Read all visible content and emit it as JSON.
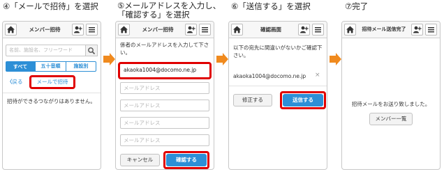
{
  "steps": [
    {
      "title": "④「メールで招待」を選択",
      "header": "メンバー招待",
      "search_placeholder": "名前、施設名、フリーワード",
      "tabs": [
        "すべて",
        "五十音順",
        "施設別"
      ],
      "back": "戻る",
      "mail_invite": "メールで招待",
      "message": "招待ができるつながりはありません。"
    },
    {
      "title": "⑤メールアドレスを入力し、\n「確認する」を選択",
      "header": "メンバー招待",
      "instruction": "係者のメールアドレスを入力して下さい。",
      "email_value": "akaoka1004@docomo.ne.jp",
      "email_placeholder": "メールアドレス",
      "cancel": "キャンセル",
      "confirm": "確認する"
    },
    {
      "title": "⑥「送信する」を選択",
      "header": "確認画面",
      "instruction": "以下の宛先に間違いがないかご確認下さい。",
      "email": "akaoka1004@docomo.ne.jp",
      "remove": "×",
      "edit": "修正する",
      "send": "送信する"
    },
    {
      "title": "⑦完了",
      "header": "招待メール送信完了",
      "message": "招待メールをお送り致しました。",
      "member_list": "メンバー一覧"
    }
  ],
  "colors": {
    "accent": "#2d8fd6",
    "highlight": "#e00000",
    "arrow": "#f08a1e"
  }
}
